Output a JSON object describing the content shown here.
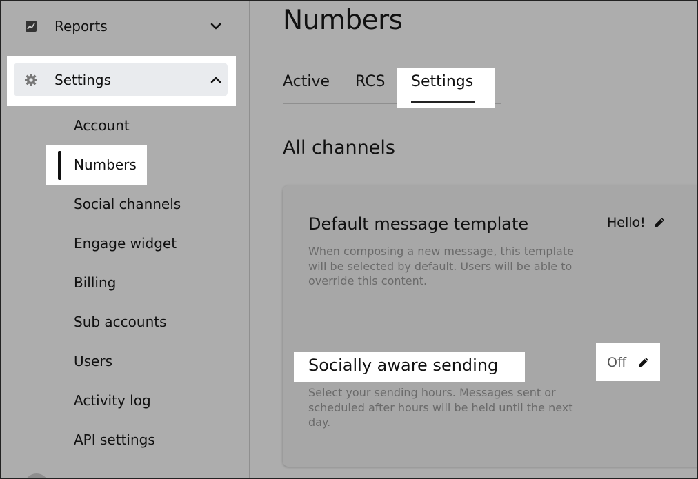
{
  "sidebar": {
    "reports": {
      "label": "Reports",
      "icon": "chart-icon",
      "chevron": "chevron-down-icon"
    },
    "settings": {
      "label": "Settings",
      "icon": "gear-icon",
      "chevron": "chevron-up-icon"
    },
    "items": [
      {
        "label": "Account"
      },
      {
        "label": "Numbers",
        "active": true
      },
      {
        "label": "Social channels"
      },
      {
        "label": "Engage widget"
      },
      {
        "label": "Billing"
      },
      {
        "label": "Sub accounts"
      },
      {
        "label": "Users"
      },
      {
        "label": "Activity log"
      },
      {
        "label": "API settings"
      }
    ]
  },
  "main": {
    "title": "Numbers",
    "tabs": [
      {
        "label": "Active"
      },
      {
        "label": "RCS"
      },
      {
        "label": "Settings",
        "selected": true
      }
    ],
    "section_title": "All channels",
    "settings": [
      {
        "title": "Default message template",
        "description": "When composing a new message, this template will be selected by default. Users will be able to override this content.",
        "value": "Hello!",
        "edit_icon": "pencil-icon"
      },
      {
        "title": "Socially aware sending",
        "description": "Select your sending hours. Messages sent or scheduled after hours will be held until the next day.",
        "value": "Off",
        "edit_icon": "pencil-icon"
      }
    ]
  },
  "colors": {
    "highlight": "#ffffff",
    "background": "#adadad",
    "settings_row": "#e9ebee",
    "muted_text": "#6a6a6a"
  }
}
